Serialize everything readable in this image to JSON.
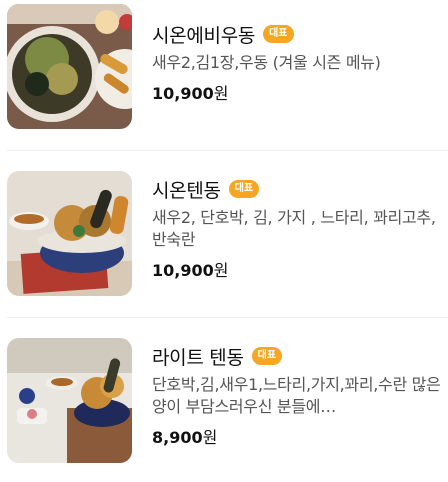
{
  "menu": {
    "items": [
      {
        "name": "시온에비우동",
        "badge": "대표",
        "description": "새우2,김1장,우동 (겨울 시즌 메뉴)",
        "price": "10,900",
        "currency": "원"
      },
      {
        "name": "시온텐동",
        "badge": "대표",
        "description": "새우2, 단호박, 김, 가지 , 느타리, 꽈리고추, 반숙란",
        "price": "10,900",
        "currency": "원"
      },
      {
        "name": "라이트 텐동",
        "badge": "대표",
        "description": "단호박,김,새우1,느타리,가지,꽈리,수란 많은 양이 부담스러우신 분들에…",
        "price": "8,900",
        "currency": "원"
      }
    ]
  }
}
